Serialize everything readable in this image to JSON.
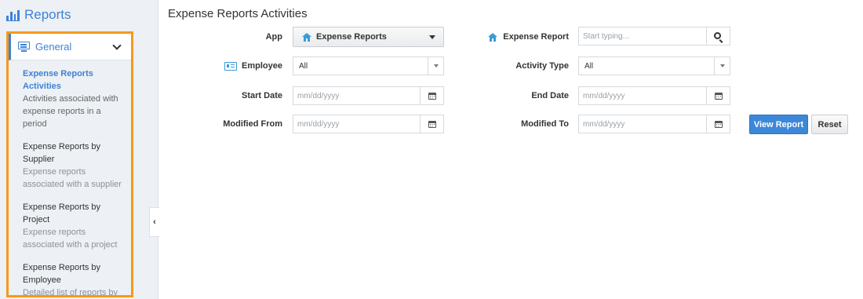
{
  "sidebar": {
    "title": "Reports",
    "group": {
      "label": "General"
    },
    "items": [
      {
        "title": "Expense Reports Activities",
        "desc": "Activities associated with expense reports in a period",
        "active": true
      },
      {
        "title": "Expense Reports by Supplier",
        "desc": "Expense reports associated with a supplier"
      },
      {
        "title": "Expense Reports by Project",
        "desc": "Expense reports associated with a project"
      },
      {
        "title": "Expense Reports by Employee",
        "desc": "Detailed list of reports by employee"
      }
    ],
    "collapse_glyph": "‹"
  },
  "main": {
    "title": "Expense Reports Activities",
    "fields": {
      "app": {
        "label": "App",
        "value": "Expense Reports"
      },
      "expense_report": {
        "label": "Expense Report",
        "placeholder": "Start typing..."
      },
      "employee": {
        "label": "Employee",
        "value": "All"
      },
      "activity_type": {
        "label": "Activity Type",
        "value": "All"
      },
      "start_date": {
        "label": "Start Date",
        "placeholder": "mm/dd/yyyy"
      },
      "end_date": {
        "label": "End Date",
        "placeholder": "mm/dd/yyyy"
      },
      "modified_from": {
        "label": "Modified From",
        "placeholder": "mm/dd/yyyy"
      },
      "modified_to": {
        "label": "Modified To",
        "placeholder": "mm/dd/yyyy"
      }
    },
    "buttons": {
      "view_report": "View Report",
      "reset": "Reset"
    }
  },
  "colors": {
    "accent": "#3d82d6",
    "highlight_border": "#f39a1e",
    "primary_button": "#3d87d8"
  }
}
